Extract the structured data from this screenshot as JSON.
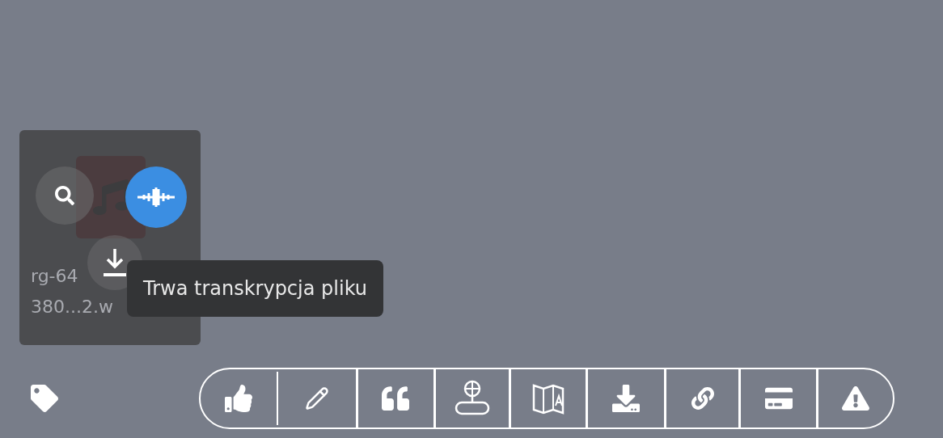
{
  "file_card": {
    "file_name_lines": [
      "rg-64",
      "380...2.w"
    ]
  },
  "tooltip": {
    "text": "Trwa transkrypcja pliku"
  }
}
